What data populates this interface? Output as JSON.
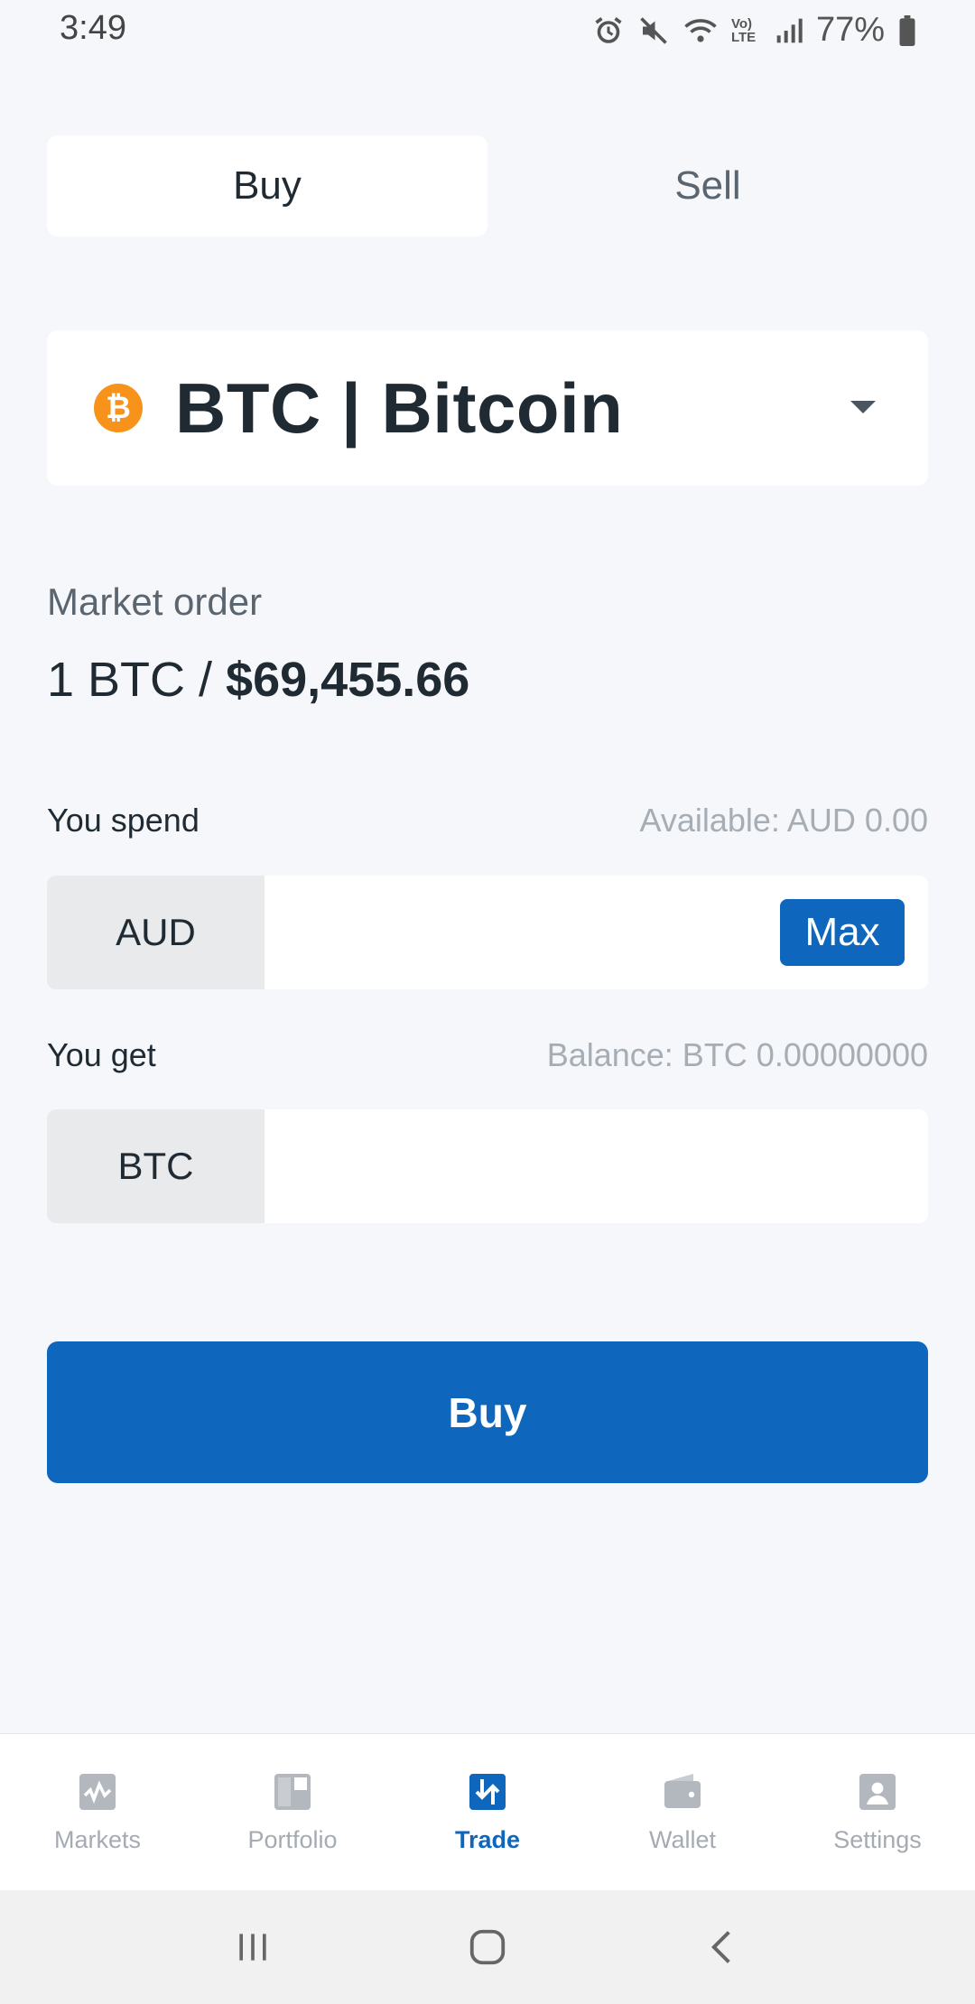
{
  "status_bar": {
    "time": "3:49",
    "battery": "77%",
    "network_label": "Vo) LTE"
  },
  "trade_toggle": {
    "buy_label": "Buy",
    "sell_label": "Sell",
    "active": "buy"
  },
  "asset": {
    "name": "BTC | Bitcoin",
    "logo_symbol": "₿",
    "logo_color": "#f7931a"
  },
  "order": {
    "label": "Market order",
    "rate_prefix": "1 BTC / ",
    "rate_value": "$69,455.66"
  },
  "spend": {
    "label": "You spend",
    "available": "Available:  AUD 0.00",
    "currency": "AUD",
    "value": "",
    "max_label": "Max"
  },
  "get": {
    "label": "You get",
    "balance": "Balance: BTC 0.00000000",
    "currency": "BTC",
    "value": ""
  },
  "primary_action": {
    "label": "Buy",
    "color": "#0f67bd"
  },
  "bottom_nav": {
    "items": [
      {
        "label": "Markets",
        "icon": "markets-icon"
      },
      {
        "label": "Portfolio",
        "icon": "portfolio-icon"
      },
      {
        "label": "Trade",
        "icon": "trade-icon"
      },
      {
        "label": "Wallet",
        "icon": "wallet-icon"
      },
      {
        "label": "Settings",
        "icon": "settings-icon"
      }
    ],
    "active": "Trade"
  }
}
